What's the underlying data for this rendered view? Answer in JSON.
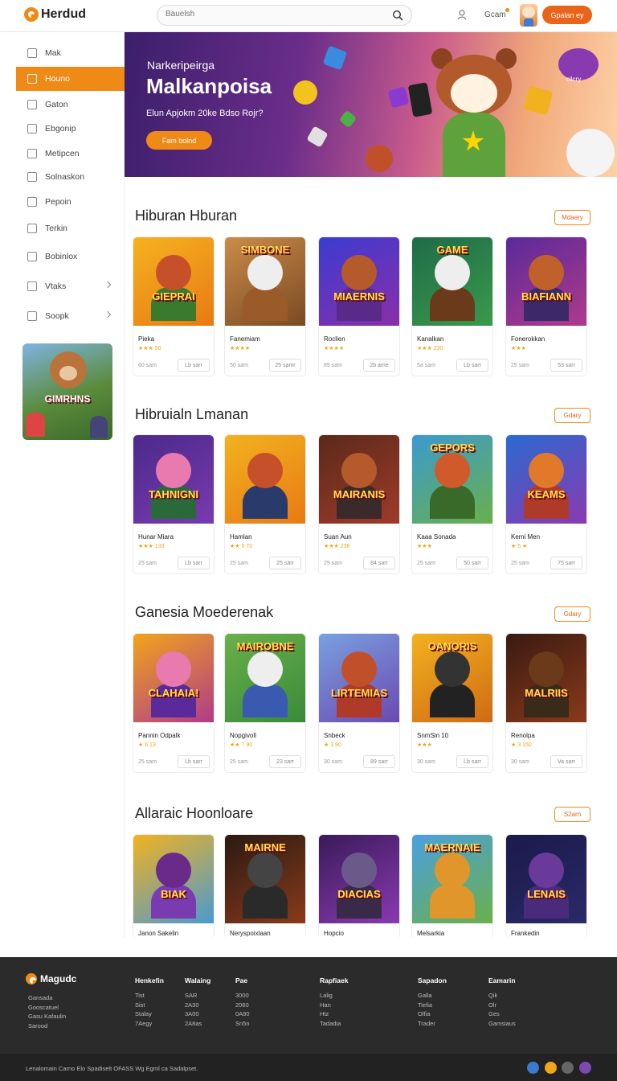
{
  "header": {
    "logo_text": "Herdud",
    "search_placeholder": "Bauelsh",
    "coins_label": "Gcam",
    "cta_label": "Gpalan ey"
  },
  "sidebar": {
    "items": [
      {
        "label": "Mak",
        "icon": "people-icon"
      },
      {
        "label": "Houno",
        "icon": "home-icon",
        "active": true
      },
      {
        "label": "Gaton",
        "icon": "grid-icon"
      },
      {
        "label": "Ebgonip",
        "icon": "folder-icon"
      },
      {
        "label": "Metipcen",
        "icon": "calendar-icon"
      },
      {
        "label": "Solnaskon",
        "icon": "doc-icon"
      },
      {
        "label": "Pepoin",
        "icon": "settings-icon"
      },
      {
        "label": "Terkin",
        "icon": "clock-icon"
      },
      {
        "label": "Bobinlox",
        "icon": "box-icon"
      },
      {
        "label": "Vtaks",
        "icon": "list-icon",
        "chevron": true
      },
      {
        "label": "Soopk",
        "icon": "tag-icon",
        "chevron": true
      }
    ],
    "promo_text": "GIMRHNS"
  },
  "hero": {
    "kicker": "Narkeripeirga",
    "title": "Malkanpoisa",
    "subtitle": "Elun  Apjokm   20ke  Bdso Rojr?",
    "button_label": "Fam bolnd",
    "corner_label": "cilcry"
  },
  "sections": [
    {
      "title": "Hiburan Hburan",
      "see_all": "Mdaery",
      "cards": [
        {
          "thumb_title": "GIEPRAI",
          "name": "Pieka",
          "meta": "★★★ 50",
          "plays": "60 sam",
          "button": "Lb sarr",
          "colors": [
            "#f6b21f",
            "#e87a14"
          ],
          "char": "#c5502a",
          "body": "#3a7a2f"
        },
        {
          "thumb_title": "SIMBONE",
          "name": "Fanemiam",
          "meta": "★★★★",
          "plays": "50 sam",
          "button": "25 samr",
          "colors": [
            "#c98c4a",
            "#7a4a22"
          ],
          "char": "#eee",
          "body": "#9a5a2a"
        },
        {
          "thumb_title": "MIAERNIS",
          "name": "Roclien",
          "meta": "★★★★",
          "plays": "89 sam",
          "button": "2b ame",
          "colors": [
            "#3b3bd1",
            "#8a2fa8"
          ],
          "char": "#b55a2a",
          "body": "#5a2a8a"
        },
        {
          "thumb_title": "GAME",
          "name": "Kanalkan",
          "meta": "★★★ 230",
          "plays": "5a sam",
          "button": "Lb sarr",
          "colors": [
            "#1f6b4a",
            "#3a9a4a"
          ],
          "char": "#eee",
          "body": "#6a3a1a"
        },
        {
          "thumb_title": "BIAFIANN",
          "name": "Fonerokkan",
          "meta": "★★★",
          "plays": "25 sam",
          "button": "53 sarr",
          "colors": [
            "#5a2a9a",
            "#b03a8a"
          ],
          "char": "#c0602a",
          "body": "#3a2a6a"
        }
      ]
    },
    {
      "title": "Hibruialn Lmanan",
      "see_all": "Gdary",
      "cards": [
        {
          "thumb_title": "TAHNIGNI",
          "name": "Hunar Miara",
          "meta": "★★★ 133",
          "plays": "25 sam",
          "button": "Lb sarr",
          "colors": [
            "#4a2a8a",
            "#7a3ab0"
          ],
          "char": "#e87ab0",
          "body": "#2a6a3a"
        },
        {
          "thumb_title": "",
          "name": "Hamlan",
          "meta": "★★ 5 70",
          "plays": "25 sam",
          "button": "25 sarr",
          "colors": [
            "#f2b21f",
            "#e87a14"
          ],
          "char": "#c5502a",
          "body": "#2a3a6a"
        },
        {
          "thumb_title": "MAIRANIS",
          "name": "Suan Aun",
          "meta": "★★★ 238",
          "plays": "29 sam",
          "button": "84 sarr",
          "colors": [
            "#5a2a1a",
            "#a03a2a"
          ],
          "char": "#b55a2a",
          "body": "#3a2a2a"
        },
        {
          "thumb_title": "GEPORS",
          "name": "Kaaa Sonada",
          "meta": "★★★",
          "plays": "25 sam",
          "button": "50 sarr",
          "colors": [
            "#3a9ad0",
            "#6ab04a"
          ],
          "char": "#d05a2a",
          "body": "#3a6a2a"
        },
        {
          "thumb_title": "KEAMS",
          "name": "Kemi Men",
          "meta": "★ 5 ★",
          "plays": "25 sam",
          "button": "75 sarr",
          "colors": [
            "#2a6ad0",
            "#8a3ab0"
          ],
          "char": "#e07a2a",
          "body": "#b03a2a"
        }
      ]
    },
    {
      "title": "Ganesia Moederenak",
      "see_all": "Gdary",
      "cards": [
        {
          "thumb_title": "CLAHAIA!",
          "name": "Pannin Odpalk",
          "meta": "★ 6 13",
          "plays": "25 sam",
          "button": "Lb sarr",
          "colors": [
            "#f0a51a",
            "#b03a8a"
          ],
          "char": "#e87ab0",
          "body": "#5a2a9a"
        },
        {
          "thumb_title": "MAIROBNE",
          "name": "Nopgivoll",
          "meta": "★★ 7 90",
          "plays": "25 sam",
          "button": "23 sarr",
          "colors": [
            "#6ab04a",
            "#3a8a3a"
          ],
          "char": "#eee",
          "body": "#3a5ab0"
        },
        {
          "thumb_title": "LIRTEMIAS",
          "name": "Snbeck",
          "meta": "★ 3 90",
          "plays": "30 sam",
          "button": "89 sarr",
          "colors": [
            "#7aa0e0",
            "#6a4ab0"
          ],
          "char": "#c0502a",
          "body": "#b03a2a"
        },
        {
          "thumb_title": "OANORIS",
          "name": "SnmSin 10",
          "meta": "★★★",
          "plays": "30 sam",
          "button": "Lb sarr",
          "colors": [
            "#f2b21f",
            "#d06a14"
          ],
          "char": "#333",
          "body": "#222"
        },
        {
          "thumb_title": "MALRIIS",
          "name": "Renolpa",
          "meta": "★ 3 150",
          "plays": "30 sam",
          "button": "Va sarr",
          "colors": [
            "#3a1a12",
            "#8a3a1a"
          ],
          "char": "#6a3a1a",
          "body": "#3a2a1a"
        }
      ]
    },
    {
      "title": "Allaraic Hoonloare",
      "see_all": "S2arn",
      "cards": [
        {
          "thumb_title": "BIAK",
          "name": "Janon Sakelin",
          "meta": "",
          "plays": "",
          "button": "",
          "colors": [
            "#f2b21f",
            "#4a9ad0"
          ],
          "char": "#6a2a8a",
          "body": "#7a3ab0"
        },
        {
          "thumb_title": "MAIRNE",
          "name": "Neryspoixlaan",
          "meta": "",
          "plays": "",
          "button": "",
          "colors": [
            "#2a1a12",
            "#8a3a1a"
          ],
          "char": "#444",
          "body": "#2a2a2a"
        },
        {
          "thumb_title": "DIACIAS",
          "name": "Hopcio",
          "meta": "",
          "plays": "",
          "button": "",
          "colors": [
            "#3a1a5a",
            "#8a3ab0"
          ],
          "char": "#6a5a8a",
          "body": "#3a2a4a"
        },
        {
          "thumb_title": "MAERNAIE",
          "name": "Melsarkia",
          "meta": "",
          "plays": "",
          "button": "",
          "colors": [
            "#4aa0e0",
            "#6ab04a"
          ],
          "char": "#e0962a",
          "body": "#e0962a"
        },
        {
          "thumb_title": "LENAIS",
          "name": "Frankedin",
          "meta": "",
          "plays": "",
          "button": "",
          "colors": [
            "#1a1a4a",
            "#2a2a6a"
          ],
          "char": "#6a3a9a",
          "body": "#4a2a7a"
        }
      ]
    }
  ],
  "footer": {
    "logo_text": "Magudc",
    "left_links": [
      "Gansada",
      "Gooscatuel",
      "Gasu Kafaulin",
      "Sarood"
    ],
    "columns": [
      {
        "title": "Henkefin",
        "items": [
          "Tist",
          "Sist",
          "Stalay",
          "7Aegy"
        ]
      },
      {
        "title": "Walaing",
        "items": [
          "SAR",
          "2A30",
          "3A00",
          "2A8as"
        ]
      },
      {
        "title": "Pae",
        "items": [
          "3000",
          "2060",
          "0A80",
          "Sn5n"
        ]
      },
      {
        "title": "Rapfiaek",
        "items": [
          "Lalig",
          "Han",
          "Htz",
          "Tadadia"
        ]
      },
      {
        "title": "Sapadon",
        "items": [
          "Galla",
          "Tiefia",
          "Olfia",
          "Trader"
        ]
      },
      {
        "title": "Eamarin",
        "items": [
          "Qik",
          "Olr",
          "Ges",
          "Gamsiaus"
        ]
      }
    ],
    "copyright": "Lenalomain Carno Elo   Spadiselt  OFASS Wg Egml ca Sadalpset.",
    "social": [
      {
        "icon": "globe-icon",
        "color": "#3a7ad0"
      },
      {
        "icon": "bolt-icon",
        "color": "#f0a51a"
      },
      {
        "icon": "shield-icon",
        "color": "#666"
      },
      {
        "icon": "dots-icon",
        "color": "#7a4ab0"
      }
    ]
  }
}
